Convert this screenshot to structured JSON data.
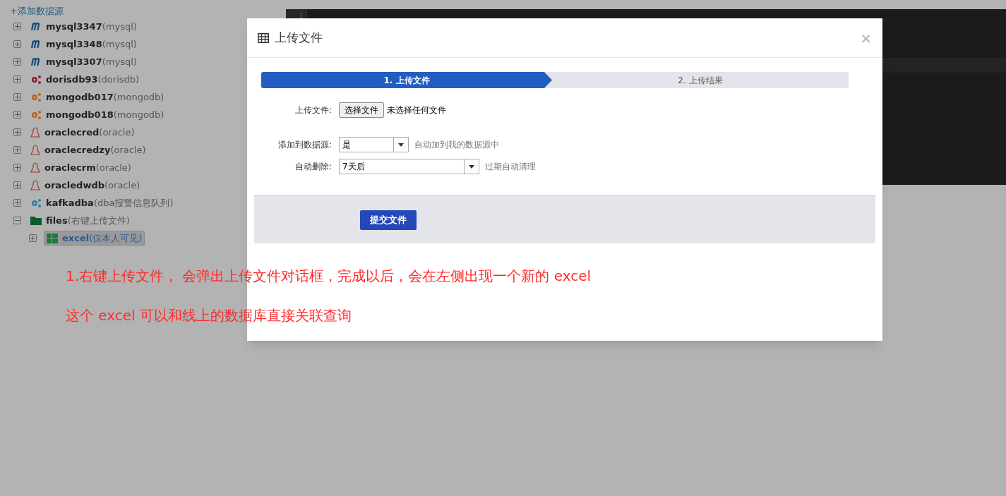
{
  "sidebar": {
    "add_link": "+添加数据源",
    "items": [
      {
        "name": "mysql3347",
        "type": "(mysql)",
        "kind": "mysql",
        "expanded": false,
        "selected": false
      },
      {
        "name": "mysql3348",
        "type": "(mysql)",
        "kind": "mysql",
        "expanded": false,
        "selected": false
      },
      {
        "name": "mysql3307",
        "type": "(mysql)",
        "kind": "mysql",
        "expanded": false,
        "selected": false
      },
      {
        "name": "dorisdb93",
        "type": "(dorisdb)",
        "kind": "gear",
        "color": "#8c1c3e",
        "expanded": false,
        "selected": false
      },
      {
        "name": "mongodb017",
        "type": "(mongodb)",
        "kind": "gear",
        "color": "#b5641e",
        "expanded": false,
        "selected": false
      },
      {
        "name": "mongodb018",
        "type": "(mongodb)",
        "kind": "gear",
        "color": "#b5641e",
        "expanded": false,
        "selected": false
      },
      {
        "name": "oraclecred",
        "type": "(oracle)",
        "kind": "oracle",
        "expanded": false,
        "selected": false
      },
      {
        "name": "oraclecredzy",
        "type": "(oracle)",
        "kind": "oracle",
        "expanded": false,
        "selected": false
      },
      {
        "name": "oraclecrm",
        "type": "(oracle)",
        "kind": "oracle",
        "expanded": false,
        "selected": false
      },
      {
        "name": "oracledwdb",
        "type": "(oracle)",
        "kind": "oracle",
        "expanded": false,
        "selected": false
      },
      {
        "name": "kafkadba",
        "type": "(dba报警信息队列)",
        "kind": "gear",
        "color": "#2b84a8",
        "expanded": false,
        "selected": false
      },
      {
        "name": "files",
        "type": "(右键上传文件)",
        "kind": "folder",
        "expanded": true,
        "selected": false,
        "children": [
          {
            "name": "excel",
            "type": "(仅本人可见)",
            "kind": "excel",
            "expanded": false,
            "selected": true
          }
        ]
      }
    ]
  },
  "editor": {
    "line_numbers": [
      "1"
    ]
  },
  "dialog": {
    "title": "上传文件",
    "close": "×",
    "steps": [
      {
        "label": "1. 上传文件",
        "selected": true
      },
      {
        "label": "2. 上传结果",
        "selected": false
      }
    ],
    "file_field": {
      "label": "上传文件:",
      "button": "选择文件",
      "value": "未选择任何文件"
    },
    "selects": [
      {
        "label": "添加到数据源:",
        "value": "是",
        "hint": "自动加到我的数据源中"
      },
      {
        "label": "自动删除:",
        "value": "7天后",
        "hint": "过期自动清理"
      }
    ],
    "submit": "提交文件"
  },
  "annotations": [
    "1.右键上传文件， 会弹出上传文件对话框，完成以后，会在左侧出现一个新的 excel",
    "这个 excel 可以和线上的数据库直接关联查询"
  ]
}
